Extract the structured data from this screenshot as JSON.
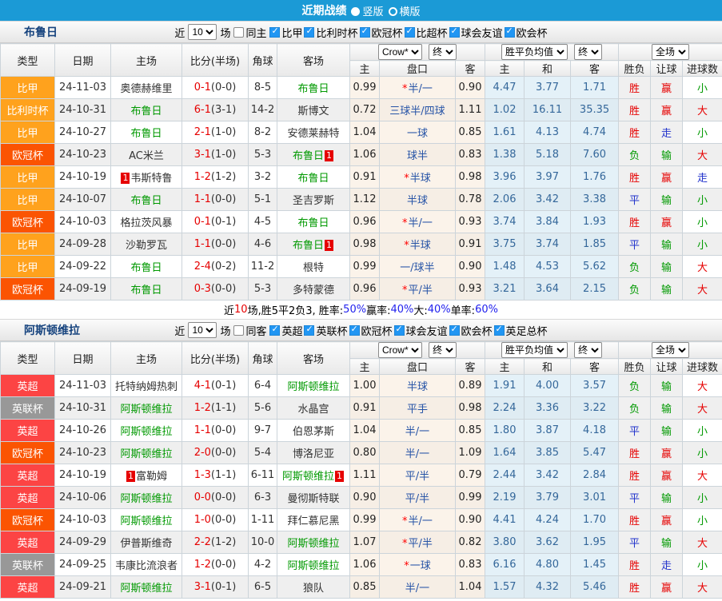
{
  "topbar": {
    "title": "近期战绩",
    "vertical_label": "竖版",
    "horizontal_label": "横版"
  },
  "filter_labels": {
    "near": "近",
    "count": "10",
    "games": "场"
  },
  "table_header": {
    "type": "类型",
    "date": "日期",
    "home": "主场",
    "score": "比分(半场)",
    "corner": "角球",
    "away": "客场",
    "company_select": "Crow*",
    "final_select": "终",
    "avg_select": "胜平负均值",
    "scope_select": "全场",
    "sub_home": "主",
    "sub_pan": "盘口",
    "sub_away": "客",
    "sub_avg_home": "主",
    "sub_avg_draw": "和",
    "sub_avg_away": "客",
    "sub_res": "胜负",
    "sub_let": "让球",
    "sub_goal": "进球数"
  },
  "colors": {
    "topbar": "#1B9AD6",
    "league": {
      "or": "#FFA21D",
      "dp": "#FB5402",
      "rd": "#FC4444",
      "gy": "#989898"
    },
    "text": {
      "r": "#E60000",
      "b": "#2233CC",
      "g": "#009900"
    }
  },
  "sections": [
    {
      "team": "布鲁日",
      "same_filter": "同主",
      "leagues": [
        "比甲",
        "比利时杯",
        "欧冠杯",
        "比超杯",
        "球会友谊",
        "欧会杯"
      ],
      "rows": [
        {
          "lg": "比甲",
          "lc": "or",
          "dt": "24-11-03",
          "hm": "奥德赫维里",
          "hb": "",
          "hg": false,
          "sc": "0-1",
          "hf": "(0-0)",
          "cn": "8-5",
          "aw": "布鲁日",
          "ab": "",
          "ag": true,
          "oh": "0.99",
          "st": true,
          "pk": "半/一",
          "oa": "0.90",
          "ah": "4.47",
          "ad": "3.77",
          "aa": "1.71",
          "rw": "胜",
          "rwc": "r",
          "rl": "赢",
          "rlc": "r",
          "rg": "小",
          "rgc": "g"
        },
        {
          "lg": "比利时杯",
          "lc": "or",
          "dt": "24-10-31",
          "hm": "布鲁日",
          "hb": "",
          "hg": true,
          "sc": "6-1",
          "hf": "(3-1)",
          "cn": "14-2",
          "aw": "斯博文",
          "ab": "",
          "ag": false,
          "oh": "0.72",
          "st": false,
          "pk": "三球半/四球",
          "oa": "1.11",
          "ah": "1.02",
          "ad": "16.11",
          "aa": "35.35",
          "rw": "胜",
          "rwc": "r",
          "rl": "赢",
          "rlc": "r",
          "rg": "大",
          "rgc": "r"
        },
        {
          "lg": "比甲",
          "lc": "or",
          "dt": "24-10-27",
          "hm": "布鲁日",
          "hb": "",
          "hg": true,
          "sc": "2-1",
          "hf": "(1-0)",
          "cn": "8-2",
          "aw": "安德莱赫特",
          "ab": "",
          "ag": false,
          "oh": "1.04",
          "st": false,
          "pk": "一球",
          "oa": "0.85",
          "ah": "1.61",
          "ad": "4.13",
          "aa": "4.74",
          "rw": "胜",
          "rwc": "r",
          "rl": "走",
          "rlc": "b",
          "rg": "小",
          "rgc": "g"
        },
        {
          "lg": "欧冠杯",
          "lc": "dp",
          "dt": "24-10-23",
          "hm": "AC米兰",
          "hb": "",
          "hg": false,
          "sc": "3-1",
          "hf": "(1-0)",
          "cn": "5-3",
          "aw": "布鲁日",
          "ab": "1",
          "ag": true,
          "oh": "1.06",
          "st": false,
          "pk": "球半",
          "oa": "0.83",
          "ah": "1.38",
          "ad": "5.18",
          "aa": "7.60",
          "rw": "负",
          "rwc": "g",
          "rl": "输",
          "rlc": "g",
          "rg": "大",
          "rgc": "r"
        },
        {
          "lg": "比甲",
          "lc": "or",
          "dt": "24-10-19",
          "hm": "韦斯特鲁",
          "hb": "1",
          "hg": false,
          "sc": "1-2",
          "hf": "(1-2)",
          "cn": "3-2",
          "aw": "布鲁日",
          "ab": "",
          "ag": true,
          "oh": "0.91",
          "st": true,
          "pk": "半球",
          "oa": "0.98",
          "ah": "3.96",
          "ad": "3.97",
          "aa": "1.76",
          "rw": "胜",
          "rwc": "r",
          "rl": "赢",
          "rlc": "r",
          "rg": "走",
          "rgc": "b"
        },
        {
          "lg": "比甲",
          "lc": "or",
          "dt": "24-10-07",
          "hm": "布鲁日",
          "hb": "",
          "hg": true,
          "sc": "1-1",
          "hf": "(0-0)",
          "cn": "5-1",
          "aw": "圣吉罗斯",
          "ab": "",
          "ag": false,
          "oh": "1.12",
          "st": false,
          "pk": "半球",
          "oa": "0.78",
          "ah": "2.06",
          "ad": "3.42",
          "aa": "3.38",
          "rw": "平",
          "rwc": "b",
          "rl": "输",
          "rlc": "g",
          "rg": "小",
          "rgc": "g"
        },
        {
          "lg": "欧冠杯",
          "lc": "dp",
          "dt": "24-10-03",
          "hm": "格拉茨风暴",
          "hb": "",
          "hg": false,
          "sc": "0-1",
          "hf": "(0-1)",
          "cn": "4-5",
          "aw": "布鲁日",
          "ab": "",
          "ag": true,
          "oh": "0.96",
          "st": true,
          "pk": "半/一",
          "oa": "0.93",
          "ah": "3.74",
          "ad": "3.84",
          "aa": "1.93",
          "rw": "胜",
          "rwc": "r",
          "rl": "赢",
          "rlc": "r",
          "rg": "小",
          "rgc": "g"
        },
        {
          "lg": "比甲",
          "lc": "or",
          "dt": "24-09-28",
          "hm": "沙勒罗瓦",
          "hb": "",
          "hg": false,
          "sc": "1-1",
          "hf": "(0-0)",
          "cn": "4-6",
          "aw": "布鲁日",
          "ab": "1",
          "ag": true,
          "oh": "0.98",
          "st": true,
          "pk": "半球",
          "oa": "0.91",
          "ah": "3.75",
          "ad": "3.74",
          "aa": "1.85",
          "rw": "平",
          "rwc": "b",
          "rl": "输",
          "rlc": "g",
          "rg": "小",
          "rgc": "g"
        },
        {
          "lg": "比甲",
          "lc": "or",
          "dt": "24-09-22",
          "hm": "布鲁日",
          "hb": "",
          "hg": true,
          "sc": "2-4",
          "hf": "(0-2)",
          "cn": "11-2",
          "aw": "根特",
          "ab": "",
          "ag": false,
          "oh": "0.99",
          "st": false,
          "pk": "一/球半",
          "oa": "0.90",
          "ah": "1.48",
          "ad": "4.53",
          "aa": "5.62",
          "rw": "负",
          "rwc": "g",
          "rl": "输",
          "rlc": "g",
          "rg": "大",
          "rgc": "r"
        },
        {
          "lg": "欧冠杯",
          "lc": "dp",
          "dt": "24-09-19",
          "hm": "布鲁日",
          "hb": "",
          "hg": true,
          "sc": "0-3",
          "hf": "(0-0)",
          "cn": "5-3",
          "aw": "多特蒙德",
          "ab": "",
          "ag": false,
          "oh": "0.96",
          "st": true,
          "pk": "平/半",
          "oa": "0.93",
          "ah": "3.21",
          "ad": "3.64",
          "aa": "2.15",
          "rw": "负",
          "rwc": "g",
          "rl": "输",
          "rlc": "g",
          "rg": "大",
          "rgc": "r"
        }
      ],
      "summary": [
        {
          "t": "近",
          "c": "k"
        },
        {
          "t": "10",
          "c": "r"
        },
        {
          "t": "场,胜5平2负3, 胜率:",
          "c": "k"
        },
        {
          "t": "50%",
          "c": "b"
        },
        {
          "t": " 赢率:",
          "c": "k"
        },
        {
          "t": "40%",
          "c": "b"
        },
        {
          "t": " 大:",
          "c": "k"
        },
        {
          "t": "40%",
          "c": "b"
        },
        {
          "t": " 单率:",
          "c": "k"
        },
        {
          "t": "60%",
          "c": "b"
        }
      ]
    },
    {
      "team": "阿斯顿维拉",
      "same_filter": "同客",
      "leagues": [
        "英超",
        "英联杯",
        "欧冠杯",
        "球会友谊",
        "欧会杯",
        "英足总杯"
      ],
      "rows": [
        {
          "lg": "英超",
          "lc": "rd",
          "dt": "24-11-03",
          "hm": "托特纳姆热刺",
          "hb": "",
          "hg": false,
          "sc": "4-1",
          "hf": "(0-1)",
          "cn": "6-4",
          "aw": "阿斯顿维拉",
          "ab": "",
          "ag": true,
          "oh": "1.00",
          "st": false,
          "pk": "半球",
          "oa": "0.89",
          "ah": "1.91",
          "ad": "4.00",
          "aa": "3.57",
          "rw": "负",
          "rwc": "g",
          "rl": "输",
          "rlc": "g",
          "rg": "大",
          "rgc": "r"
        },
        {
          "lg": "英联杯",
          "lc": "gy",
          "dt": "24-10-31",
          "hm": "阿斯顿维拉",
          "hb": "",
          "hg": true,
          "sc": "1-2",
          "hf": "(1-1)",
          "cn": "5-6",
          "aw": "水晶宫",
          "ab": "",
          "ag": false,
          "oh": "0.91",
          "st": false,
          "pk": "平手",
          "oa": "0.98",
          "ah": "2.24",
          "ad": "3.36",
          "aa": "3.22",
          "rw": "负",
          "rwc": "g",
          "rl": "输",
          "rlc": "g",
          "rg": "大",
          "rgc": "r"
        },
        {
          "lg": "英超",
          "lc": "rd",
          "dt": "24-10-26",
          "hm": "阿斯顿维拉",
          "hb": "",
          "hg": true,
          "sc": "1-1",
          "hf": "(0-0)",
          "cn": "9-7",
          "aw": "伯恩茅斯",
          "ab": "",
          "ag": false,
          "oh": "1.04",
          "st": false,
          "pk": "半/一",
          "oa": "0.85",
          "ah": "1.80",
          "ad": "3.87",
          "aa": "4.18",
          "rw": "平",
          "rwc": "b",
          "rl": "输",
          "rlc": "g",
          "rg": "小",
          "rgc": "g"
        },
        {
          "lg": "欧冠杯",
          "lc": "dp",
          "dt": "24-10-23",
          "hm": "阿斯顿维拉",
          "hb": "",
          "hg": true,
          "sc": "2-0",
          "hf": "(0-0)",
          "cn": "5-4",
          "aw": "博洛尼亚",
          "ab": "",
          "ag": false,
          "oh": "0.80",
          "st": false,
          "pk": "半/一",
          "oa": "1.09",
          "ah": "1.64",
          "ad": "3.85",
          "aa": "5.47",
          "rw": "胜",
          "rwc": "r",
          "rl": "赢",
          "rlc": "r",
          "rg": "小",
          "rgc": "g"
        },
        {
          "lg": "英超",
          "lc": "rd",
          "dt": "24-10-19",
          "hm": "富勒姆",
          "hb": "1",
          "hg": false,
          "sc": "1-3",
          "hf": "(1-1)",
          "cn": "6-11",
          "aw": "阿斯顿维拉",
          "ab": "1",
          "ag": true,
          "oh": "1.11",
          "st": false,
          "pk": "平/半",
          "oa": "0.79",
          "ah": "2.44",
          "ad": "3.42",
          "aa": "2.84",
          "rw": "胜",
          "rwc": "r",
          "rl": "赢",
          "rlc": "r",
          "rg": "大",
          "rgc": "r"
        },
        {
          "lg": "英超",
          "lc": "rd",
          "dt": "24-10-06",
          "hm": "阿斯顿维拉",
          "hb": "",
          "hg": true,
          "sc": "0-0",
          "hf": "(0-0)",
          "cn": "6-3",
          "aw": "曼彻斯特联",
          "ab": "",
          "ag": false,
          "oh": "0.90",
          "st": false,
          "pk": "平/半",
          "oa": "0.99",
          "ah": "2.19",
          "ad": "3.79",
          "aa": "3.01",
          "rw": "平",
          "rwc": "b",
          "rl": "输",
          "rlc": "g",
          "rg": "小",
          "rgc": "g"
        },
        {
          "lg": "欧冠杯",
          "lc": "dp",
          "dt": "24-10-03",
          "hm": "阿斯顿维拉",
          "hb": "",
          "hg": true,
          "sc": "1-0",
          "hf": "(0-0)",
          "cn": "1-11",
          "aw": "拜仁慕尼黑",
          "ab": "",
          "ag": false,
          "oh": "0.99",
          "st": true,
          "pk": "半/一",
          "oa": "0.90",
          "ah": "4.41",
          "ad": "4.24",
          "aa": "1.70",
          "rw": "胜",
          "rwc": "r",
          "rl": "赢",
          "rlc": "r",
          "rg": "小",
          "rgc": "g"
        },
        {
          "lg": "英超",
          "lc": "rd",
          "dt": "24-09-29",
          "hm": "伊普斯维奇",
          "hb": "",
          "hg": false,
          "sc": "2-2",
          "hf": "(1-2)",
          "cn": "10-0",
          "aw": "阿斯顿维拉",
          "ab": "",
          "ag": true,
          "oh": "1.07",
          "st": true,
          "pk": "平/半",
          "oa": "0.82",
          "ah": "3.80",
          "ad": "3.62",
          "aa": "1.95",
          "rw": "平",
          "rwc": "b",
          "rl": "输",
          "rlc": "g",
          "rg": "大",
          "rgc": "r"
        },
        {
          "lg": "英联杯",
          "lc": "gy",
          "dt": "24-09-25",
          "hm": "韦康比流浪者",
          "hb": "",
          "hg": false,
          "sc": "1-2",
          "hf": "(0-0)",
          "cn": "4-2",
          "aw": "阿斯顿维拉",
          "ab": "",
          "ag": true,
          "oh": "1.06",
          "st": true,
          "pk": "一球",
          "oa": "0.83",
          "ah": "6.16",
          "ad": "4.80",
          "aa": "1.45",
          "rw": "胜",
          "rwc": "r",
          "rl": "走",
          "rlc": "b",
          "rg": "小",
          "rgc": "g"
        },
        {
          "lg": "英超",
          "lc": "rd",
          "dt": "24-09-21",
          "hm": "阿斯顿维拉",
          "hb": "",
          "hg": true,
          "sc": "3-1",
          "hf": "(0-1)",
          "cn": "6-5",
          "aw": "狼队",
          "ab": "",
          "ag": false,
          "oh": "0.85",
          "st": false,
          "pk": "半/一",
          "oa": "1.04",
          "ah": "1.57",
          "ad": "4.32",
          "aa": "5.46",
          "rw": "胜",
          "rwc": "r",
          "rl": "赢",
          "rlc": "r",
          "rg": "大",
          "rgc": "r"
        }
      ],
      "summary": []
    }
  ]
}
